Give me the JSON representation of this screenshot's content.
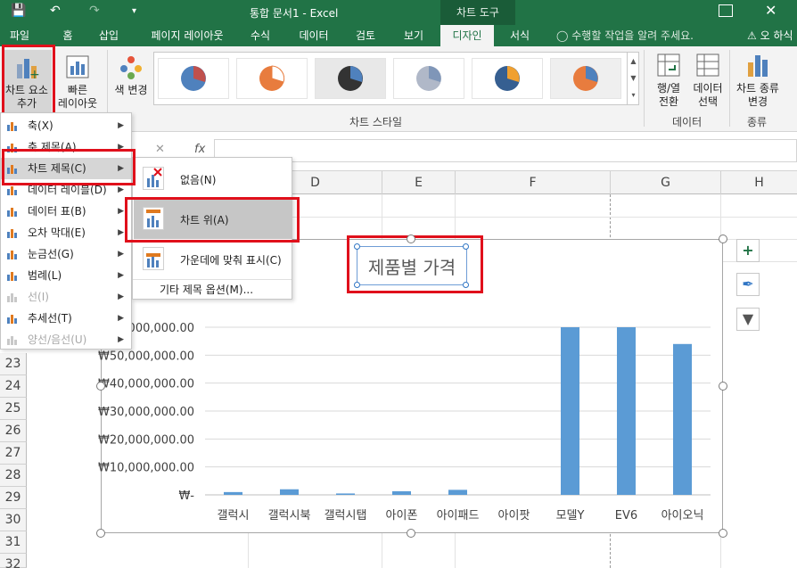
{
  "titlebar": {
    "doc_title": "통합 문서1 - Excel",
    "chart_tools": "차트 도구",
    "icons": [
      "save-icon",
      "undo-icon",
      "redo-icon",
      "customize-qat-icon"
    ]
  },
  "tabs": [
    "파일",
    "홈",
    "삽입",
    "페이지 레이아웃",
    "수식",
    "데이터",
    "검토",
    "보기",
    "디자인",
    "서식"
  ],
  "active_tab": "디자인",
  "tell_me": "수행할 작업을 알려 주세요.",
  "share_label": "오 하식",
  "ribbon": {
    "add_element": "차트 요소\n추가",
    "quick_layout": "빠른\n레이아웃",
    "change_colors": "색 변경",
    "chart_styles_group": "차트 스타일",
    "switch_row_col": "행/열\n전환",
    "select_data": "데이터\n선택",
    "data_group": "데이터",
    "change_type": "차트 종류\n변경",
    "type_group": "종류"
  },
  "formula": {
    "fx_label": "fx",
    "check": "✓",
    "cancel": "✕"
  },
  "columns": [
    "D",
    "E",
    "F",
    "G",
    "H"
  ],
  "rows": [
    "23",
    "24",
    "25",
    "26",
    "27",
    "28",
    "29",
    "30",
    "31",
    "32"
  ],
  "menu_add_element": [
    {
      "label": "축(X)",
      "enabled": true,
      "submenu": true
    },
    {
      "label": "축 제목(A)",
      "enabled": true,
      "submenu": true
    },
    {
      "label": "차트 제목(C)",
      "enabled": true,
      "submenu": true,
      "highlighted": true
    },
    {
      "label": "데이터 레이블(D)",
      "enabled": true,
      "submenu": true
    },
    {
      "label": "데이터 표(B)",
      "enabled": true,
      "submenu": true
    },
    {
      "label": "오차 막대(E)",
      "enabled": true,
      "submenu": true
    },
    {
      "label": "눈금선(G)",
      "enabled": true,
      "submenu": true
    },
    {
      "label": "범례(L)",
      "enabled": true,
      "submenu": true
    },
    {
      "label": "선(I)",
      "enabled": false,
      "submenu": true
    },
    {
      "label": "추세선(T)",
      "enabled": true,
      "submenu": true
    },
    {
      "label": "양선/음선(U)",
      "enabled": false,
      "submenu": true
    }
  ],
  "menu_chart_title": [
    {
      "label": "없음(N)",
      "highlighted": false
    },
    {
      "label": "차트 위(A)",
      "highlighted": true
    },
    {
      "label": "가운데에 맞춰 표시(C)",
      "highlighted": false
    }
  ],
  "menu_more_options": "기타 제목 옵션(M)...",
  "chart_data": {
    "type": "bar",
    "title": "제품별 가격",
    "categories": [
      "갤럭시",
      "갤럭시북",
      "갤럭시탭",
      "아이폰",
      "아이패드",
      "아이팟",
      "모델Y",
      "EV6",
      "아이오닉"
    ],
    "values": [
      1000000,
      2000000,
      500000,
      1300000,
      1800000,
      0,
      60000000,
      60000000,
      54000000
    ],
    "ylim": [
      0,
      60000000
    ],
    "y_tick_labels": [
      "₩-",
      "₩10,000,000.00",
      "₩20,000,000.00",
      "₩30,000,000.00",
      "₩40,000,000.00",
      "₩50,000,000.00",
      "₩60,000,000.00"
    ],
    "bar_color": "#5b9bd5",
    "grid": true
  },
  "colors": {
    "excel_green": "#217346",
    "highlight_red": "#e0101b",
    "bar": "#5b9bd5"
  }
}
